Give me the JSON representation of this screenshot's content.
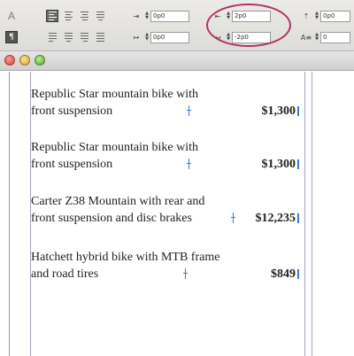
{
  "toolbar": {
    "char_mode_label": "A",
    "para_mode_label": "¶",
    "left_indent": {
      "icon": "left-indent-icon",
      "value": "0p0"
    },
    "first_line_indent": {
      "icon": "first-line-indent-icon",
      "value": "0p0"
    },
    "right_indent": {
      "icon": "right-indent-icon",
      "value": "2p0"
    },
    "last_line_right_indent": {
      "icon": "last-line-right-indent-icon",
      "value": "-2p0"
    },
    "space_before": {
      "icon": "space-before-icon",
      "value": "0p0"
    },
    "drop_cap_lines": {
      "icon": "drop-cap-lines-icon",
      "value": "0"
    }
  },
  "highlight_color": "#b0326a",
  "document": {
    "entries": [
      {
        "line1": "Republic Star mountain bike with",
        "line2": "front suspension",
        "price": "$1,300"
      },
      {
        "line1": "Republic Star mountain bike with",
        "line2": "front suspension",
        "price": "$1,300"
      },
      {
        "line1": "Carter Z38 Mountain with rear and",
        "line2": "front suspension and disc brakes",
        "price": "$12,235"
      },
      {
        "line1": "Hatchett hybrid bike with MTB frame",
        "line2": "and road tires",
        "price": "$849"
      }
    ]
  }
}
